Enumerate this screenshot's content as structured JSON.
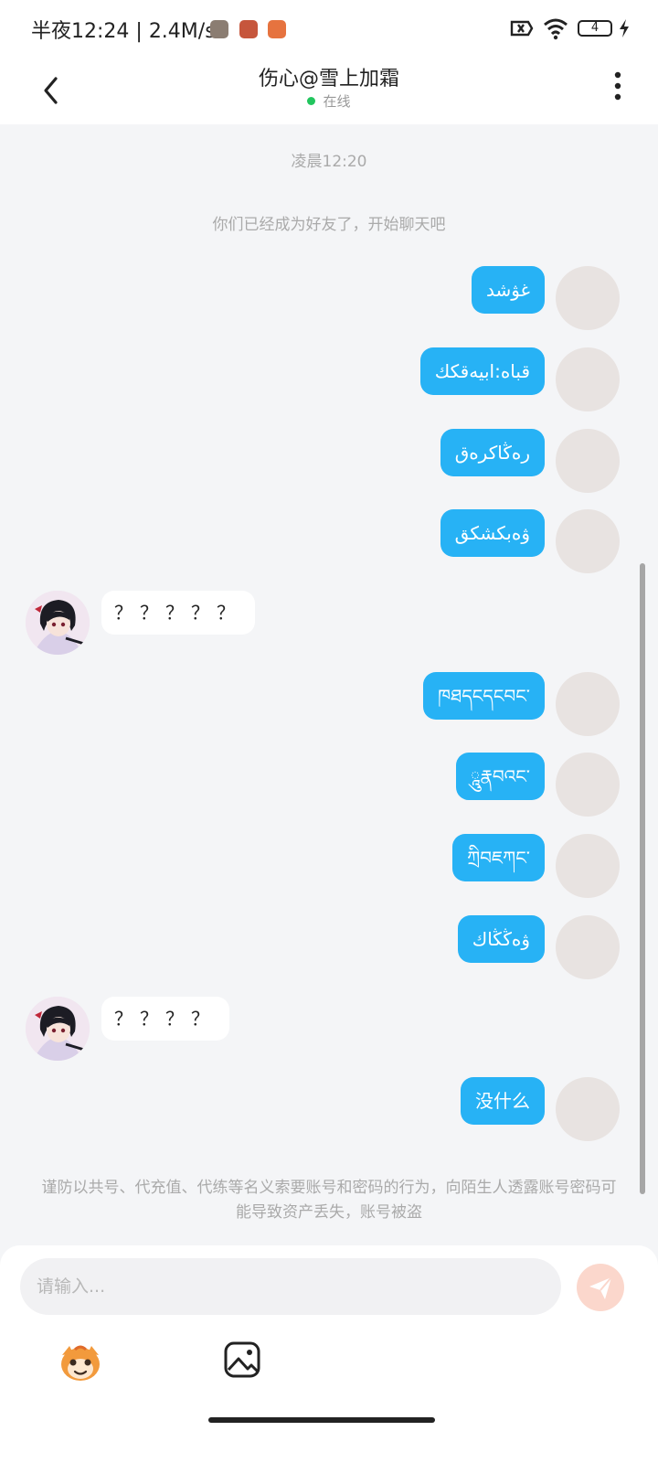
{
  "status_bar": {
    "time": "半夜12:24",
    "speed": "2.4M/s",
    "battery": "4",
    "icons": [
      "sim-off-icon",
      "wifi-icon",
      "battery-icon",
      "charging-icon"
    ]
  },
  "header": {
    "title": "伤心@雪上加霜",
    "status": "在线",
    "status_color": "#22c55e"
  },
  "chat": {
    "time_label": "凌晨12:20",
    "system_notice": "你们已经成为好友了，开始聊天吧",
    "messages": [
      {
        "sender": "me",
        "text": "غۋشد"
      },
      {
        "sender": "me",
        "text": "قباه:ابيەقكك"
      },
      {
        "sender": "me",
        "text": "رەڭاكرەق"
      },
      {
        "sender": "me",
        "text": "ۋەبكشكق"
      },
      {
        "sender": "other",
        "text": "？？？？？"
      },
      {
        "sender": "me",
        "text": "ཁཐདངདངབང་"
      },
      {
        "sender": "me",
        "text": "ཱུརྣབའང་"
      },
      {
        "sender": "me",
        "text": "ཀྲིབཇཀང་"
      },
      {
        "sender": "me",
        "text": "ۋەڭڭاك"
      },
      {
        "sender": "other",
        "text": "？？？？"
      },
      {
        "sender": "me",
        "text": "没什么"
      }
    ],
    "warning": "谨防以共号、代充值、代练等名义索要账号和密码的行为，向陌生人透露账号密码可能导致资产丢失，账号被盗"
  },
  "input": {
    "placeholder": "请输入...",
    "value": ""
  },
  "colors": {
    "accent_bubble": "#27b2f5",
    "send_button": "#fbd7cc",
    "background": "#f4f5f7"
  },
  "icons": {
    "back": "back-arrow-icon",
    "more": "more-vertical-icon",
    "send": "send-icon",
    "emoji": "sticker-icon",
    "image": "image-icon"
  }
}
